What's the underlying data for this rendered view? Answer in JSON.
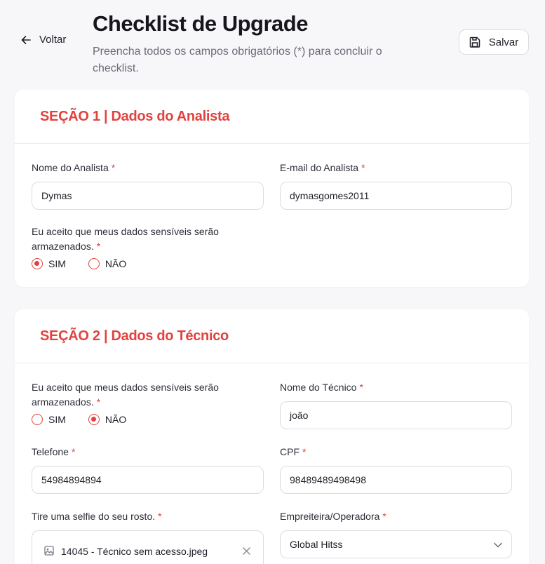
{
  "header": {
    "back_label": "Voltar",
    "title": "Checklist de Upgrade",
    "subtitle": "Preencha todos os campos obrigatórios (*) para concluir o checklist.",
    "save_label": "Salvar"
  },
  "section1": {
    "title": "SEÇÃO 1 | Dados do Analista",
    "analyst_name": {
      "label": "Nome do Analista",
      "required": "*",
      "value": "Dymas"
    },
    "analyst_email": {
      "label": "E-mail do Analista",
      "required": "*",
      "value": "dymasgomes2011"
    },
    "consent": {
      "label": "Eu aceito que meus dados sensíveis serão armazenados.",
      "required": "*",
      "options": [
        "SIM",
        "NÃO"
      ],
      "selected": "SIM"
    }
  },
  "section2": {
    "title": "SEÇÃO 2 | Dados do Técnico",
    "consent": {
      "label": "Eu aceito que meus dados sensíveis serão armazenados.",
      "required": "*",
      "options": [
        "SIM",
        "NÃO"
      ],
      "selected": "NÃO"
    },
    "tech_name": {
      "label": "Nome do Técnico",
      "required": "*",
      "value": "joão"
    },
    "phone": {
      "label": "Telefone",
      "required": "*",
      "value": "54984894894"
    },
    "cpf": {
      "label": "CPF",
      "required": "*",
      "value": "98489489498498"
    },
    "selfie": {
      "label": "Tire uma selfie do seu rosto.",
      "required": "*",
      "file_name": "14045 - Técnico sem acesso.jpeg"
    },
    "contractor": {
      "label": "Empreiteira/Operadora",
      "required": "*",
      "selected": "Global Hitss"
    }
  },
  "icons": {
    "back": "arrow-left-icon",
    "save": "floppy-disk-icon",
    "file": "image-icon",
    "remove": "close-icon",
    "dropdown": "chevron-down-icon"
  },
  "colors": {
    "accent": "#e2423f",
    "background": "#f7f7f9",
    "card": "#ffffff",
    "border": "#dcdce2"
  }
}
